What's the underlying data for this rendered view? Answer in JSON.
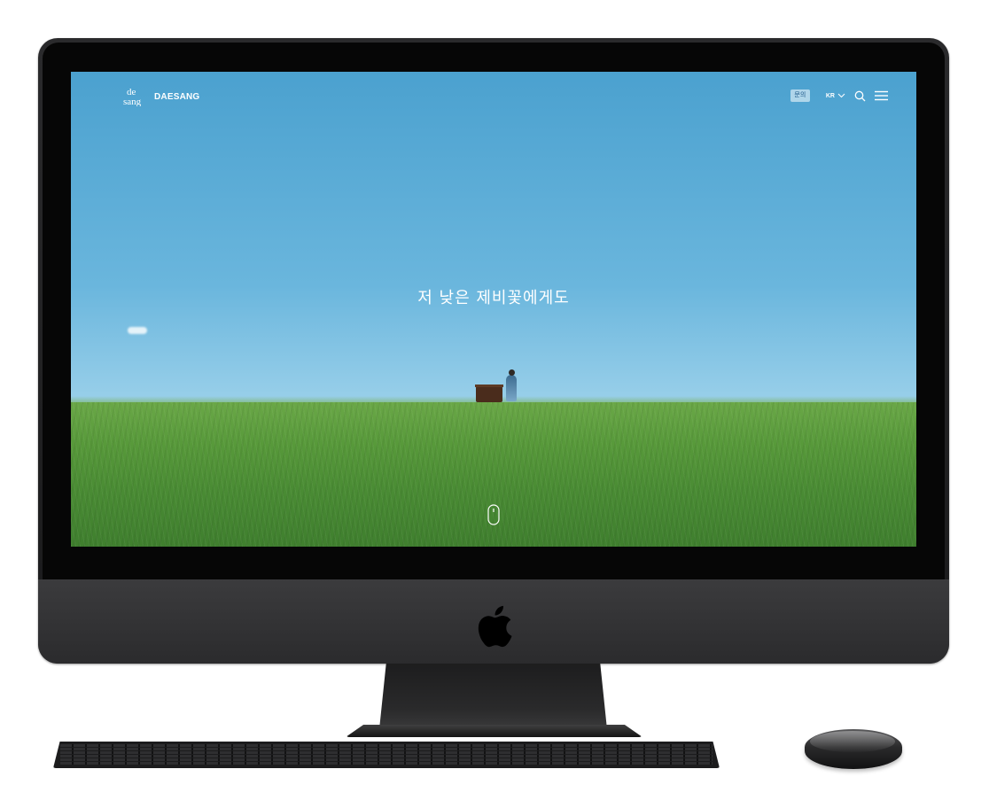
{
  "nav": {
    "logo_mark": "de\nsang",
    "logo_text": "DAESANG",
    "badge_label": "문의",
    "language": "KR"
  },
  "hero": {
    "title": "저 낮은 제비꽃에게도"
  },
  "colors": {
    "sky_top": "#4ba1cf",
    "sky_bottom": "#b4dbee",
    "grass": "#57993a",
    "device": "#2b2b2d"
  },
  "icons": {
    "search": "search-icon",
    "menu": "hamburger-menu-icon",
    "chevron": "chevron-down-icon",
    "scroll": "mouse-scroll-icon",
    "apple": "apple-logo-icon"
  }
}
